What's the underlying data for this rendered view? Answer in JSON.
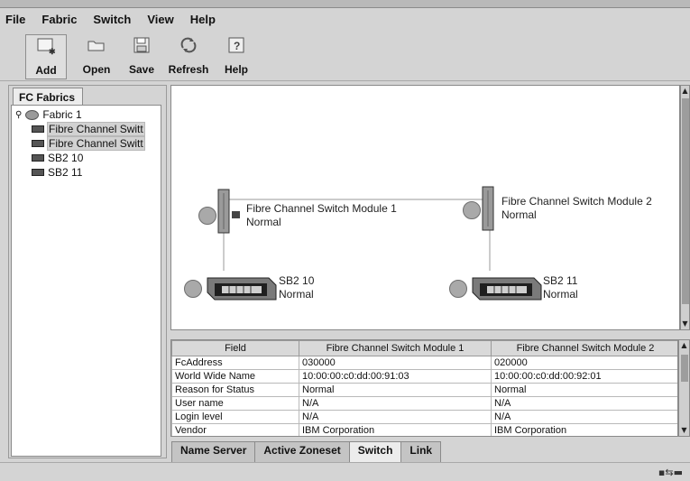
{
  "menu": [
    "File",
    "Fabric",
    "Switch",
    "View",
    "Help"
  ],
  "toolbar": {
    "add": "Add",
    "open": "Open",
    "save": "Save",
    "refresh": "Refresh",
    "help": "Help"
  },
  "left_panel": {
    "tab": "FC Fabrics",
    "tree": {
      "root": "Fabric 1",
      "children": [
        "Fibre Channel Switt",
        "Fibre Channel Switt",
        "SB2 10",
        "SB2 11"
      ]
    }
  },
  "topology": {
    "nodes": [
      {
        "name": "Fibre Channel Switch Module 1",
        "status": "Normal"
      },
      {
        "name": "Fibre Channel Switch Module 2",
        "status": "Normal"
      },
      {
        "name": "SB2 10",
        "status": "Normal"
      },
      {
        "name": "SB2 11",
        "status": "Normal"
      }
    ]
  },
  "table": {
    "headers": [
      "Field",
      "Fibre Channel Switch Module 1",
      "Fibre Channel Switch Module 2"
    ],
    "rows": [
      [
        "FcAddress",
        "030000",
        "020000"
      ],
      [
        "World Wide Name",
        "10:00:00:c0:dd:00:91:03",
        "10:00:00:c0:dd:00:92:01"
      ],
      [
        "Reason for Status",
        "Normal",
        "Normal"
      ],
      [
        "User name",
        "N/A",
        "N/A"
      ],
      [
        "Login level",
        "N/A",
        "N/A"
      ],
      [
        "Vendor",
        "IBM Corporation",
        "IBM Corporation"
      ]
    ]
  },
  "bottom_tabs": [
    "Name Server",
    "Active Zoneset",
    "Switch",
    "Link"
  ],
  "active_tab": "Switch",
  "icons": {
    "add": "add-icon",
    "open": "folder-open-icon",
    "save": "save-disk-icon",
    "refresh": "refresh-icon",
    "help": "help-icon",
    "fabric": "fabric-icon",
    "switch_node": "switch-icon",
    "status": "network-status-icon"
  }
}
